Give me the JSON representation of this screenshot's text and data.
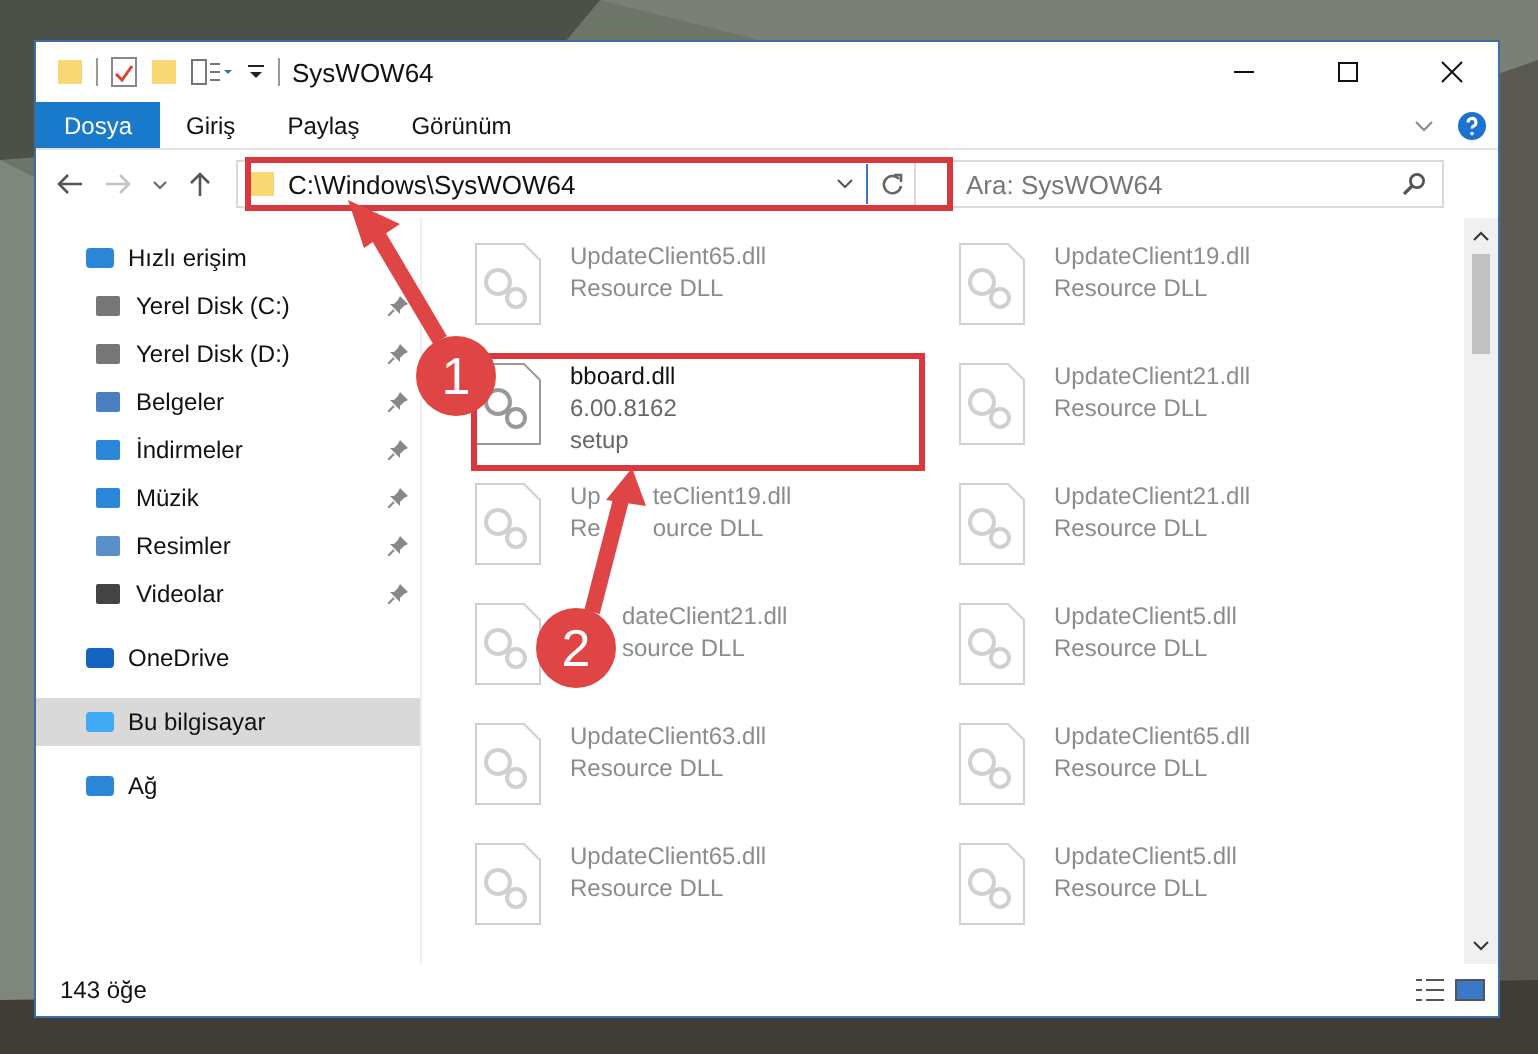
{
  "window": {
    "title": "SysWOW64"
  },
  "ribbon_tabs": [
    {
      "label": "Dosya",
      "selected": true
    },
    {
      "label": "Giriş",
      "selected": false
    },
    {
      "label": "Paylaş",
      "selected": false
    },
    {
      "label": "Görünüm",
      "selected": false
    }
  ],
  "address": {
    "path": "C:\\Windows\\SysWOW64"
  },
  "search": {
    "placeholder": "Ara: SysWOW64"
  },
  "sidebar": {
    "items": [
      {
        "label": "Hızlı erişim",
        "kind": "star",
        "selected": false,
        "children": [
          {
            "label": "Yerel Disk (C:)",
            "kind": "drive",
            "pinned": true,
            "selected": false
          },
          {
            "label": "Yerel Disk (D:)",
            "kind": "drive",
            "pinned": true,
            "selected": false
          },
          {
            "label": "Belgeler",
            "kind": "doc",
            "pinned": true,
            "selected": false
          },
          {
            "label": "İndirmeler",
            "kind": "download",
            "pinned": true,
            "selected": false
          },
          {
            "label": "Müzik",
            "kind": "music",
            "pinned": true,
            "selected": false
          },
          {
            "label": "Resimler",
            "pinned": true,
            "selected": false
          },
          {
            "label": "Videolar",
            "kind": "video",
            "pinned": true,
            "selected": false
          }
        ]
      },
      {
        "label": "OneDrive",
        "kind": "cloud",
        "selected": false
      },
      {
        "label": "Bu bilgisayar",
        "kind": "pc",
        "selected": true
      },
      {
        "label": "Ağ",
        "kind": "network",
        "selected": false
      }
    ]
  },
  "files": [
    {
      "name": "UpdateClient65.dll",
      "lines": [
        "Resource DLL"
      ],
      "dimmed": true
    },
    {
      "name": "UpdateClient19.dll",
      "lines": [
        "Resource DLL"
      ],
      "dimmed": true
    },
    {
      "name": "bboard.dll",
      "lines": [
        "6.00.8162",
        "setup"
      ],
      "dimmed": false
    },
    {
      "name": "UpdateClient21.dll",
      "lines": [
        "Resource DLL"
      ],
      "dimmed": true
    },
    {
      "name_parts": [
        {
          "text": "Up",
          "after_gap": false
        },
        {
          "text": "teClient19.dll",
          "after_gap": true
        }
      ],
      "line_parts": [
        {
          "text": "Re",
          "after_gap": false
        },
        {
          "text": "ource DLL",
          "after_gap": true
        }
      ],
      "dimmed": true
    },
    {
      "name": "UpdateClient21.dll",
      "lines": [
        "Resource DLL"
      ],
      "dimmed": true
    },
    {
      "name_parts": [
        {
          "text": "dateClient21.dll",
          "after_gap": true
        }
      ],
      "line_parts": [
        {
          "text": "source DLL",
          "after_gap": true
        }
      ],
      "dimmed": true
    },
    {
      "name": "UpdateClient5.dll",
      "lines": [
        "Resource DLL"
      ],
      "dimmed": true
    },
    {
      "name": "UpdateClient63.dll",
      "lines": [
        "Resource DLL"
      ],
      "dimmed": true
    },
    {
      "name": "UpdateClient65.dll",
      "lines": [
        "Resource DLL"
      ],
      "dimmed": true
    },
    {
      "name": "UpdateClient65.dll",
      "lines": [
        "Resource DLL"
      ],
      "dimmed": true
    },
    {
      "name": "UpdateClient5.dll",
      "lines": [
        "Resource DLL"
      ],
      "dimmed": true
    }
  ],
  "status_bar": {
    "count": "143 öğe"
  },
  "annotations": {
    "markers": [
      {
        "text": "1"
      },
      {
        "text": "2"
      }
    ]
  }
}
